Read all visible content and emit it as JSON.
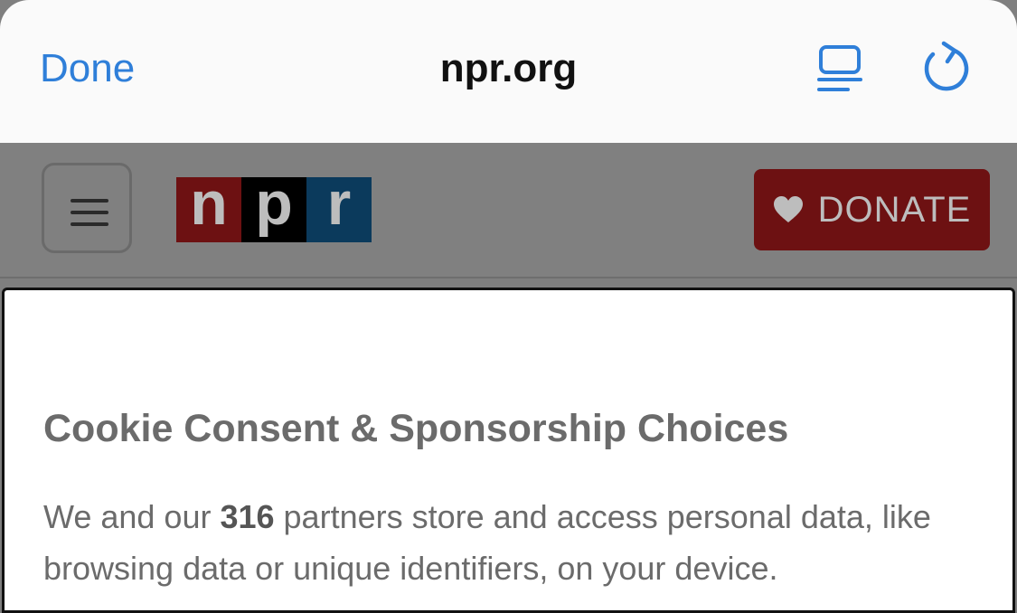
{
  "browser": {
    "done_label": "Done",
    "url_title": "npr.org",
    "reader_icon": "reader-view-icon",
    "reload_icon": "reload-icon",
    "accent_color": "#2f7fd9"
  },
  "site_header": {
    "menu_icon": "hamburger-menu-icon",
    "logo": {
      "letters": [
        "n",
        "p",
        "r"
      ],
      "colors": [
        "#6d1112",
        "#000000",
        "#0b3a5c"
      ]
    },
    "donate": {
      "label": "DONATE",
      "icon": "heart-icon",
      "color": "#6d1112"
    }
  },
  "consent": {
    "title": "Cookie Consent & Sponsorship Choices",
    "body_prefix": "We and our ",
    "partner_count": "316",
    "body_suffix": " partners store and access personal data, like browsing data or unique identifiers, on your device."
  }
}
